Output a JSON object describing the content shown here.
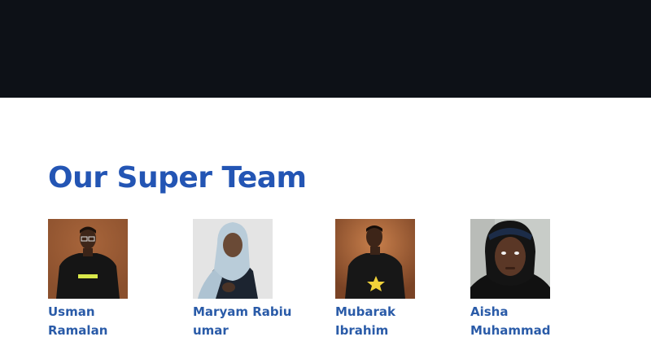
{
  "header": {
    "background": "#0d1117"
  },
  "team": {
    "title": "Our Super Team",
    "title_color": "#2355b4",
    "members": [
      {
        "name_line1": "Usman",
        "name_line2": "Ramalan",
        "photo": "portrait-man-black-tshirt-brown-background"
      },
      {
        "name_line1": "Maryam Rabiu",
        "name_line2": "umar",
        "photo": "portrait-woman-light-blue-hijab-white-background"
      },
      {
        "name_line1": "Mubarak",
        "name_line2": "Ibrahim",
        "photo": "portrait-man-star-tshirt-brown-background"
      },
      {
        "name_line1": "Aisha",
        "name_line2": "Muhammad",
        "photo": "portrait-woman-black-hijab-grey-background"
      }
    ]
  }
}
